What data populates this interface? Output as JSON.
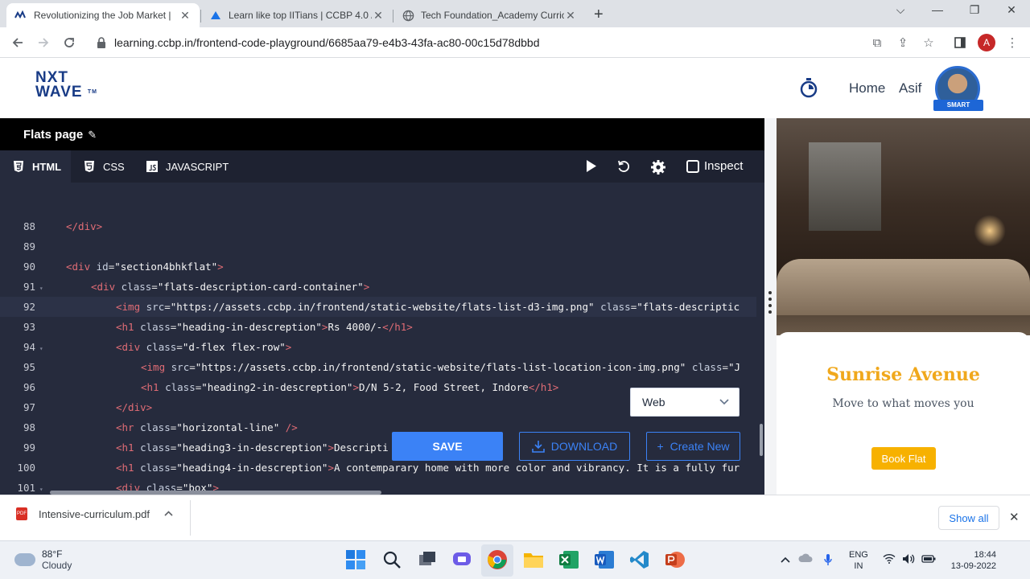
{
  "browser": {
    "tabs": [
      {
        "title": "Revolutionizing the Job Market |",
        "active": true
      },
      {
        "title": "Learn like top IITians | CCBP 4.0 /",
        "active": false
      },
      {
        "title": "Tech Foundation_Academy Curric",
        "active": false
      }
    ],
    "url": "learning.ccbp.in/frontend-code-playground/6685aa79-e4b3-43fa-ac80-00c15d78dbbd",
    "profile_initial": "A"
  },
  "site": {
    "logo_line1": "NXT",
    "logo_line2": "WAVE",
    "logo_tm": "TM",
    "nav_home": "Home",
    "nav_user": "Asif",
    "badge": "SMART"
  },
  "editor": {
    "title": "Flats page",
    "tabs": [
      "HTML",
      "CSS",
      "JAVASCRIPT"
    ],
    "inspect_label": "Inspect",
    "lines": [
      {
        "n": "88",
        "html": "<span class=\"tag\">&lt;/div&gt;</span>",
        "indent": 0
      },
      {
        "n": "89",
        "html": "",
        "indent": 0
      },
      {
        "n": "90",
        "html": "<span class=\"tag\">&lt;div</span> <span class=\"attr\">id</span>=<span class=\"val\">\"section4bhkflat\"</span><span class=\"tag\">&gt;</span>",
        "indent": 0
      },
      {
        "n": "91",
        "html": "<span class=\"tag\">&lt;div</span> <span class=\"attr\">class</span>=<span class=\"val\">\"flats-description-card-container\"</span><span class=\"tag\">&gt;</span>",
        "indent": 1,
        "fold": true
      },
      {
        "n": "92",
        "html": "<span class=\"tag\">&lt;img</span> <span class=\"attr\">src</span>=<span class=\"val\">\"https://assets.ccbp.in/frontend/static-website/flats-list-d3-img.png\"</span> <span class=\"attr\">class</span>=<span class=\"val\">\"flats-descriptic</span>",
        "indent": 2,
        "current": true
      },
      {
        "n": "93",
        "html": "<span class=\"tag\">&lt;h1</span> <span class=\"attr\">class</span>=<span class=\"val\">\"heading-in-descreption\"</span><span class=\"tag\">&gt;</span><span class=\"txt\">Rs 4000/-</span><span class=\"tag\">&lt;/h1&gt;</span>",
        "indent": 2
      },
      {
        "n": "94",
        "html": "<span class=\"tag\">&lt;div</span> <span class=\"attr\">class</span>=<span class=\"val\">\"d-flex flex-row\"</span><span class=\"tag\">&gt;</span>",
        "indent": 2,
        "fold": true
      },
      {
        "n": "95",
        "html": "<span class=\"tag\">&lt;img</span> <span class=\"attr\">src</span>=<span class=\"val\">\"https://assets.ccbp.in/frontend/static-website/flats-list-location-icon-img.png\"</span> <span class=\"attr\">class</span>=<span class=\"val\">\"J</span>",
        "indent": 3
      },
      {
        "n": "96",
        "html": "<span class=\"tag\">&lt;h1</span> <span class=\"attr\">class</span>=<span class=\"val\">\"heading2-in-descreption\"</span><span class=\"tag\">&gt;</span><span class=\"txt\">D/N 5-2, Food Street, Indore</span><span class=\"tag\">&lt;/h1&gt;</span>",
        "indent": 3
      },
      {
        "n": "97",
        "html": "<span class=\"tag\">&lt;/div&gt;</span>",
        "indent": 2
      },
      {
        "n": "98",
        "html": "<span class=\"tag\">&lt;hr</span> <span class=\"attr\">class</span>=<span class=\"val\">\"horizontal-line\"</span> <span class=\"tag\">/&gt;</span>",
        "indent": 2
      },
      {
        "n": "99",
        "html": "<span class=\"tag\">&lt;h1</span> <span class=\"attr\">class</span>=<span class=\"val\">\"heading3-in-descreption\"</span><span class=\"tag\">&gt;</span><span class=\"txt\">Descripti</span>",
        "indent": 2
      },
      {
        "n": "100",
        "html": "<span class=\"tag\">&lt;h1</span> <span class=\"attr\">class</span>=<span class=\"val\">\"heading4-in-descreption\"</span><span class=\"tag\">&gt;</span><span class=\"txt\">A contemparary home with more color and vibrancy. It is a fully fur</span>",
        "indent": 2
      },
      {
        "n": "101",
        "html": "<span class=\"tag\">&lt;div</span> <span class=\"attr\">class</span>=<span class=\"val\">\"box\"</span><span class=\"tag\">&gt;</span>",
        "indent": 2,
        "fold": true
      }
    ],
    "view_select": "Web",
    "save_label": "SAVE",
    "download_label": "DOWNLOAD",
    "create_label": "Create New"
  },
  "preview": {
    "name": "Sunrise Avenue",
    "tagline": "Move to what moves you",
    "button": "Book Flat"
  },
  "downloads": {
    "file": "Intensive-curriculum.pdf",
    "show_all": "Show all"
  },
  "taskbar": {
    "temp": "88°F",
    "weather": "Cloudy",
    "lang1": "ENG",
    "lang2": "IN",
    "time": "18:44",
    "date": "13-09-2022"
  },
  "colors": {
    "accent": "#3b82f6",
    "brand": "#183b86",
    "preview_title": "#f0a81c",
    "book_button": "#f7b100"
  }
}
